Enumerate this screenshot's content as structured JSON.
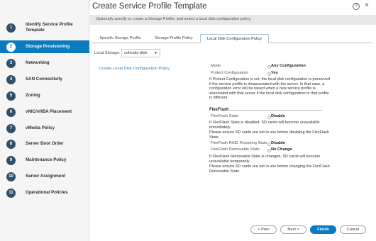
{
  "window": {
    "title": "Create Service Profile Template",
    "help_icon": "help-icon",
    "close_icon": "close-icon",
    "help_glyph": "?",
    "close_glyph": "×"
  },
  "subtitle": "Optionally specify or create a Storage Profile, and select a local disk configuration policy.",
  "steps": [
    {
      "num": "1",
      "label": "Identify Service Profile Template"
    },
    {
      "num": "2",
      "label": "Storage Provisioning",
      "active": true
    },
    {
      "num": "3",
      "label": "Networking"
    },
    {
      "num": "4",
      "label": "SAN Connectivity"
    },
    {
      "num": "5",
      "label": "Zoning"
    },
    {
      "num": "6",
      "label": "vNIC/vHBA Placement"
    },
    {
      "num": "7",
      "label": "vMedia Policy"
    },
    {
      "num": "8",
      "label": "Server Boot Order"
    },
    {
      "num": "9",
      "label": "Maintenance Policy"
    },
    {
      "num": "10",
      "label": "Server Assignment"
    },
    {
      "num": "11",
      "label": "Operational Policies"
    }
  ],
  "tabs": [
    "Specific Storage Profile",
    "Storage Profile Policy",
    "Local Disk Configuration Policy"
  ],
  "local_storage": {
    "label": "Local Storage:",
    "value": "cohesity-disk",
    "chevron": "▼"
  },
  "create_link": "Create Local Disk Configuration Policy",
  "details": {
    "mode_label": "Mode",
    "mode_value": "Any Configuration",
    "protect_label": "Protect Configuration",
    "protect_value": "Yes",
    "protect_note_bold": "Protect Configuration",
    "protect_note": "If Protect Configuration is set, the local disk configuration is preserved if the service profile is disassociated with the server. In that case, a configuration error will be raised when a new service profile is associated with that server if the local disk configuration in that profile is different.",
    "flexflash_heading": "FlexFlash",
    "ff_state_label": "FlexFlash State",
    "ff_state_value": "Disable",
    "ff_note_1": "If FlexFlash State is disabled, SD cards will become unavailable immediately.",
    "ff_note_2": "Please ensure SD cards are not in use before disabling the FlexFlash State.",
    "raid_label": "FlexFlash RAID Reporting State",
    "raid_value": "Disable",
    "removable_label": "FlexFlash Removable State",
    "removable_value": "No Change",
    "removable_note_1": "If FlexFlash Removable State is changed, SD cards will become unavailable temporarily.",
    "removable_note_2": "Please ensure SD cards are not in use before changing the FlexFlash Removable State."
  },
  "buttons": {
    "prev": "< Prev",
    "next": "Next >",
    "finish": "Finish",
    "cancel": "Cancel"
  },
  "colors": {
    "accent": "#0a7bbf",
    "step_badge": "#2f4f6a",
    "link": "#2a7ab8"
  }
}
